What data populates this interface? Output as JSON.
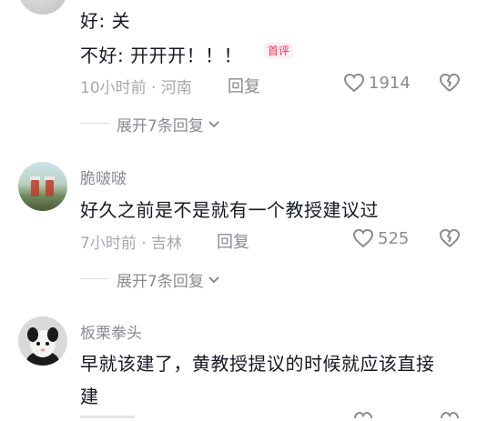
{
  "comments": [
    {
      "lines": [
        "好: 关",
        "不好: 开开开！！！"
      ],
      "badge": "首评",
      "meta": "10小时前 · 河南",
      "reply": "回复",
      "likes": "1914",
      "expand": "展开7条回复"
    },
    {
      "username": "脆啵啵",
      "text": "好久之前是不是就有一个教授建议过",
      "meta": "7小时前 · 吉林",
      "reply": "回复",
      "likes": "525",
      "expand": "展开7条回复"
    },
    {
      "username": "板栗拳头",
      "lines": [
        "早就该建了，黄教授提议的时候就应该直接",
        "建"
      ]
    }
  ]
}
